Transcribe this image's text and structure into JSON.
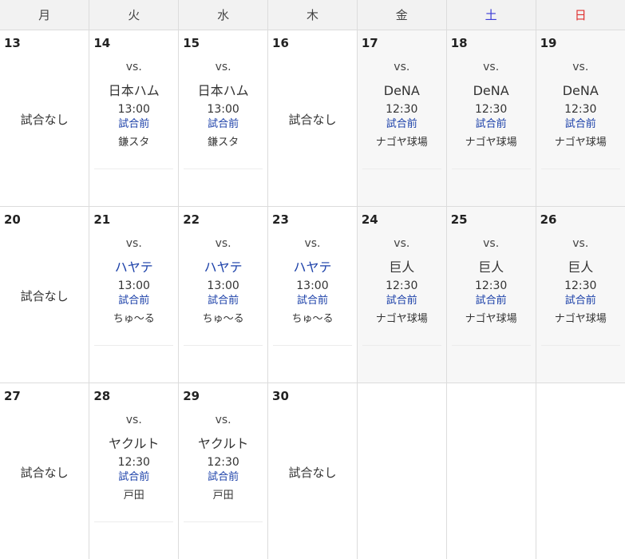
{
  "weekdays": [
    "月",
    "火",
    "水",
    "木",
    "金",
    "土",
    "日"
  ],
  "colors": {
    "saturday": "#3b3bd6",
    "sunday": "#e0302f",
    "link_blue": "#1a3fa8",
    "shaded_bg": "#f7f7f7"
  },
  "weeks": [
    [
      {
        "day": "13",
        "no_game": "試合なし"
      },
      {
        "day": "14",
        "vs": "vs.",
        "opponent": "日本ハム",
        "time": "13:00",
        "status": "試合前",
        "venue": "鎌スタ"
      },
      {
        "day": "15",
        "vs": "vs.",
        "opponent": "日本ハム",
        "time": "13:00",
        "status": "試合前",
        "venue": "鎌スタ"
      },
      {
        "day": "16",
        "no_game": "試合なし"
      },
      {
        "day": "17",
        "vs": "vs.",
        "opponent": "DeNA",
        "time": "12:30",
        "status": "試合前",
        "venue": "ナゴヤ球場"
      },
      {
        "day": "18",
        "vs": "vs.",
        "opponent": "DeNA",
        "time": "12:30",
        "status": "試合前",
        "venue": "ナゴヤ球場"
      },
      {
        "day": "19",
        "vs": "vs.",
        "opponent": "DeNA",
        "time": "12:30",
        "status": "試合前",
        "venue": "ナゴヤ球場"
      }
    ],
    [
      {
        "day": "20",
        "no_game": "試合なし"
      },
      {
        "day": "21",
        "vs": "vs.",
        "opponent": "ハヤテ",
        "time": "13:00",
        "status": "試合前",
        "venue": "ちゅ～る"
      },
      {
        "day": "22",
        "vs": "vs.",
        "opponent": "ハヤテ",
        "time": "13:00",
        "status": "試合前",
        "venue": "ちゅ～る"
      },
      {
        "day": "23",
        "vs": "vs.",
        "opponent": "ハヤテ",
        "time": "13:00",
        "status": "試合前",
        "venue": "ちゅ～る"
      },
      {
        "day": "24",
        "vs": "vs.",
        "opponent": "巨人",
        "time": "12:30",
        "status": "試合前",
        "venue": "ナゴヤ球場"
      },
      {
        "day": "25",
        "vs": "vs.",
        "opponent": "巨人",
        "time": "12:30",
        "status": "試合前",
        "venue": "ナゴヤ球場"
      },
      {
        "day": "26",
        "vs": "vs.",
        "opponent": "巨人",
        "time": "12:30",
        "status": "試合前",
        "venue": "ナゴヤ球場"
      }
    ],
    [
      {
        "day": "27",
        "no_game": "試合なし"
      },
      {
        "day": "28",
        "vs": "vs.",
        "opponent": "ヤクルト",
        "time": "12:30",
        "status": "試合前",
        "venue": "戸田"
      },
      {
        "day": "29",
        "vs": "vs.",
        "opponent": "ヤクルト",
        "time": "12:30",
        "status": "試合前",
        "venue": "戸田"
      },
      {
        "day": "30",
        "no_game": "試合なし"
      },
      {},
      {},
      {}
    ]
  ]
}
